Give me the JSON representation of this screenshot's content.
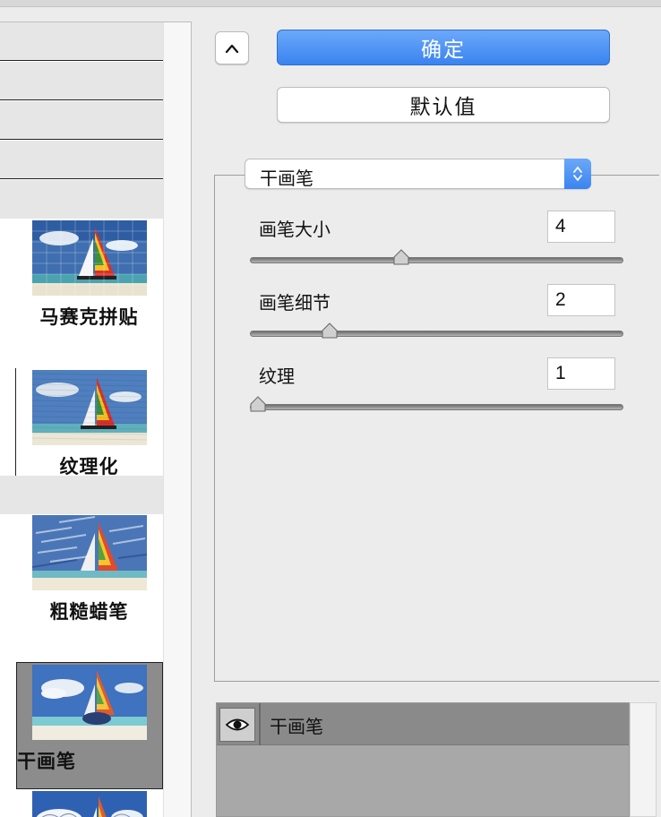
{
  "dialog": {
    "ok_label": "确定",
    "default_label": "默认值"
  },
  "filter_select": {
    "selected": "干画笔"
  },
  "params": [
    {
      "label": "画笔大小",
      "value": "4",
      "slider_fraction": 0.4
    },
    {
      "label": "画笔细节",
      "value": "2",
      "slider_fraction": 0.2
    },
    {
      "label": "纹理",
      "value": "1",
      "slider_fraction": 0.0
    }
  ],
  "gallery": {
    "thumbnails": [
      {
        "label": "马赛克拼贴"
      },
      {
        "label": "纹理化"
      },
      {
        "label": "粗糙蜡笔"
      },
      {
        "label": "干画笔",
        "selected": true
      },
      {
        "label": ""
      }
    ]
  },
  "effect_layers": [
    {
      "label": "干画笔"
    }
  ],
  "colors": {
    "accent_blue": "#3a84f0",
    "selected_thumb_bg": "#8c8c8c"
  }
}
